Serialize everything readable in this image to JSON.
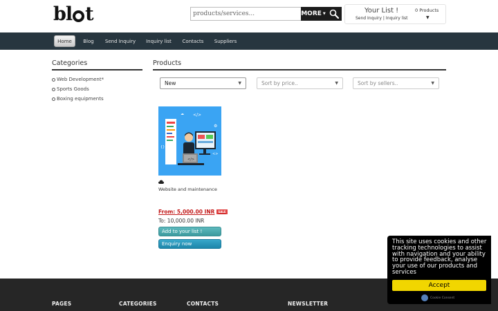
{
  "header": {
    "logo_text_1": "bl",
    "logo_text_2": "t",
    "search_placeholder": "products/services...",
    "more_label": "MORE",
    "cart": {
      "title": "Your List !",
      "send_inquiry": "Send Inquiry",
      "separator": "|",
      "inquiry_list": "Inquiry list",
      "count_label": "0 Products"
    }
  },
  "nav": {
    "items": [
      {
        "label": "Home",
        "active": true
      },
      {
        "label": "Blog"
      },
      {
        "label": "Send Inquiry"
      },
      {
        "label": "Inquiry list"
      },
      {
        "label": "Contacts"
      },
      {
        "label": "Suppliers"
      }
    ]
  },
  "sidebar": {
    "title": "Categories",
    "items": [
      {
        "label": "Web Development*"
      },
      {
        "label": "Sports Goods"
      },
      {
        "label": "Boxing equipments"
      }
    ]
  },
  "products": {
    "title": "Products",
    "filters": {
      "sort_new": "New",
      "sort_price": "Sort by price..",
      "sort_sellers": "Sort by sellers.."
    },
    "items": [
      {
        "name": "Website and maintenance",
        "price_from": "From: 5,000.00 INR",
        "badge": "SALE",
        "price_to": "To: 10,000.00 INR",
        "add_label": "Add to your list !",
        "enquiry_label": "Enquiry now"
      }
    ]
  },
  "footer": {
    "col_pages": "PAGES",
    "col_categories": "CATEGORIES",
    "col_contacts": "CONTACTS",
    "col_newsletter": "NEWSLETTER"
  },
  "cookie": {
    "message": "This site uses cookies and other tracking technologies to assist with navigation and your ability to provide feedback, analyse your use of our products and services",
    "accept_label": "Accept",
    "brand": "Cookie Consent"
  },
  "colors": {
    "nav_bg": "#27363f",
    "footer_bg": "#262626",
    "price_red": "#c21a1a",
    "cookie_yellow": "#f1d600",
    "product_blue": "#3aa4f3"
  }
}
